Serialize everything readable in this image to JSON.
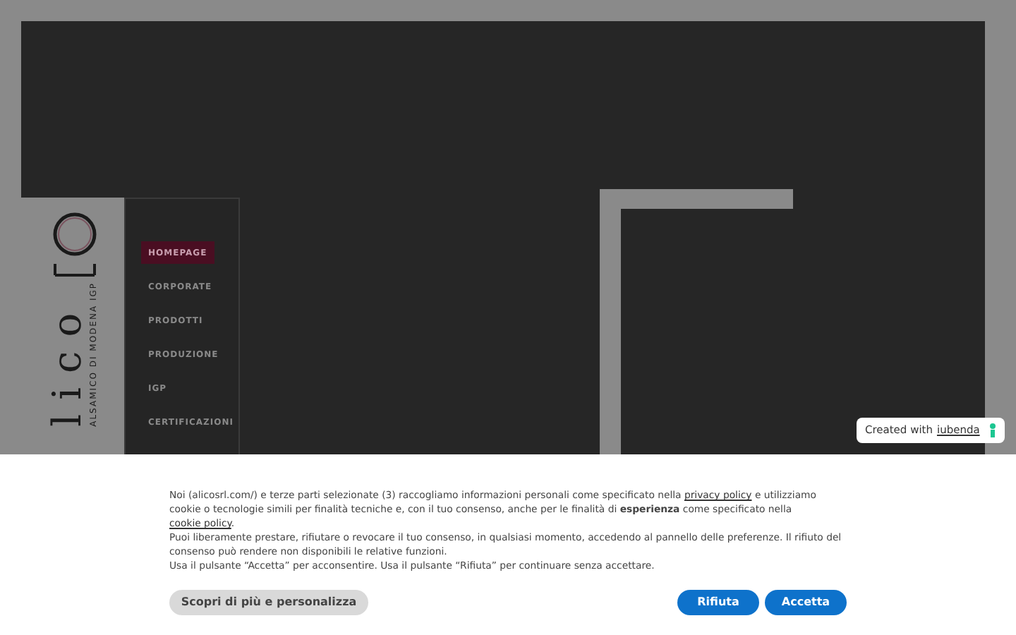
{
  "logo": {
    "letters": "lico",
    "tagline": "ALSAMICO DI MODENA IGP"
  },
  "menu": [
    {
      "label": "HOMEPAGE",
      "selected": true
    },
    {
      "label": "CORPORATE",
      "selected": false
    },
    {
      "label": "PRODOTTI",
      "selected": false
    },
    {
      "label": "PRODUZIONE",
      "selected": false
    },
    {
      "label": "IGP",
      "selected": false
    },
    {
      "label": "CERTIFICAZIONI",
      "selected": false
    }
  ],
  "badge": {
    "prefix": "Created with",
    "link": "iubenda"
  },
  "cookie_banner": {
    "intro": [
      {
        "kind": "text",
        "text": "Noi (alicosrl.com/) e terze parti selezionate (3) raccogliamo informazioni personali come specificato nella"
      },
      {
        "kind": "link",
        "text": "privacy policy"
      },
      {
        "kind": "text",
        "text": "e utilizziamo cookie o tecnologie simili per finalità tecniche e, con il tuo consenso, anche per le finalità di **esperienza** come specificato nella"
      },
      {
        "kind": "link",
        "text": "cookie policy"
      },
      {
        "kind": "text",
        "text": "."
      }
    ],
    "paragraphs": [
      "Puoi liberamente prestare, rifiutare o revocare il tuo consenso, in qualsiasi momento, accedendo al pannello delle preferenze. Il rifiuto del consenso può rendere non disponibili le relative funzioni.",
      "Usa il pulsante “Accetta” per acconsentire. Usa il pulsante “Rifiuta” per continuare senza accettare."
    ],
    "buttons": [
      {
        "label": "Scopri di più e personalizza",
        "kind": "secondary"
      },
      {
        "label": "Rifiuta",
        "kind": "primary"
      },
      {
        "label": "Accetta",
        "kind": "primary"
      }
    ]
  }
}
